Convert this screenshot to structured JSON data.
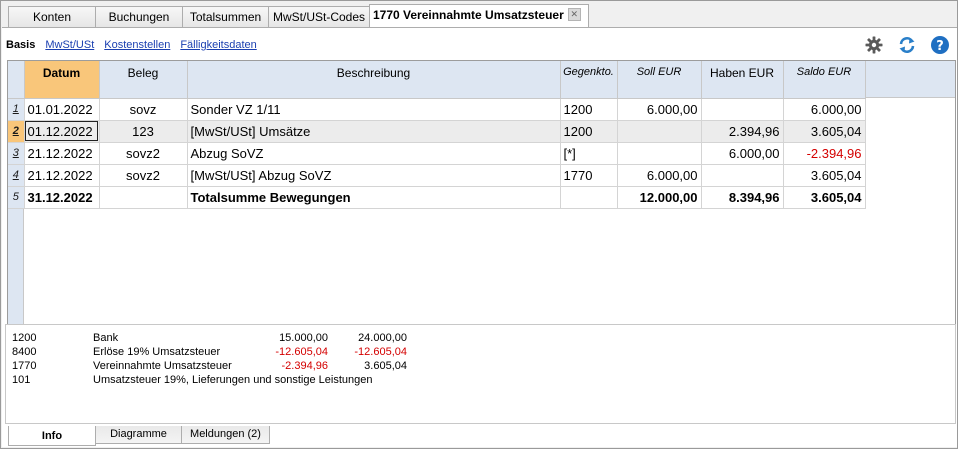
{
  "tabs": [
    {
      "label": "Konten"
    },
    {
      "label": "Buchungen"
    },
    {
      "label": "Totalsummen"
    },
    {
      "label": "MwSt/USt-Codes"
    },
    {
      "label": "1770 Vereinnahmte Umsatzsteuer",
      "active": true
    }
  ],
  "view_links": {
    "current": "Basis",
    "links": [
      "MwSt/USt",
      "Kostenstellen",
      "Fälligkeitsdaten"
    ]
  },
  "toolbar_icons": [
    "gear-icon",
    "refresh-icon",
    "help-icon"
  ],
  "columns": [
    "Datum",
    "Beleg",
    "Beschreibung",
    "Gegenkto.",
    "Soll EUR",
    "Haben EUR",
    "Saldo EUR"
  ],
  "rows": [
    {
      "num": "1",
      "datum": "01.01.2022",
      "beleg": "sovz",
      "beschreibung": "Sonder VZ 1/11",
      "gegenkto": "1200",
      "soll": "6.000,00",
      "haben": "",
      "saldo": "6.000,00"
    },
    {
      "num": "2",
      "datum": "01.12.2022",
      "beleg": "123",
      "beschreibung": "[MwSt/USt] Umsätze",
      "gegenkto": "1200",
      "soll": "",
      "haben": "2.394,96",
      "saldo": "3.605,04"
    },
    {
      "num": "3",
      "datum": "21.12.2022",
      "beleg": "sovz2",
      "beschreibung": "Abzug SoVZ",
      "gegenkto": "[*]",
      "soll": "",
      "haben": "6.000,00",
      "saldo": "-2.394,96"
    },
    {
      "num": "4",
      "datum": "21.12.2022",
      "beleg": "sovz2",
      "beschreibung": "[MwSt/USt] Abzug SoVZ",
      "gegenkto": "1770",
      "soll": "6.000,00",
      "haben": "",
      "saldo": "3.605,04"
    },
    {
      "num": "5",
      "datum": "31.12.2022",
      "beleg": "",
      "beschreibung": "Totalsumme Bewegungen",
      "gegenkto": "",
      "soll": "12.000,00",
      "haben": "8.394,96",
      "saldo": "3.605,04"
    }
  ],
  "info": [
    {
      "account": "1200",
      "description": "Bank",
      "v1": "15.000,00",
      "v2": "24.000,00"
    },
    {
      "account": "8400",
      "description": "Erlöse 19% Umsatzsteuer",
      "v1": "-12.605,04",
      "v2": "-12.605,04"
    },
    {
      "account": "1770",
      "description": "Vereinnahmte Umsatzsteuer",
      "v1": "-2.394,96",
      "v2": "3.605,04"
    },
    {
      "account": "101",
      "description": "Umsatzsteuer 19%, Lieferungen und sonstige Leistungen",
      "v1": "",
      "v2": ""
    }
  ],
  "bottom_tabs": [
    "Info",
    "Diagramme",
    "Meldungen (2)"
  ],
  "colors": {
    "header_bg": "#dde6f2",
    "active_header": "#f9c67a",
    "negative": "#d40000",
    "link": "#1a3fb0"
  }
}
